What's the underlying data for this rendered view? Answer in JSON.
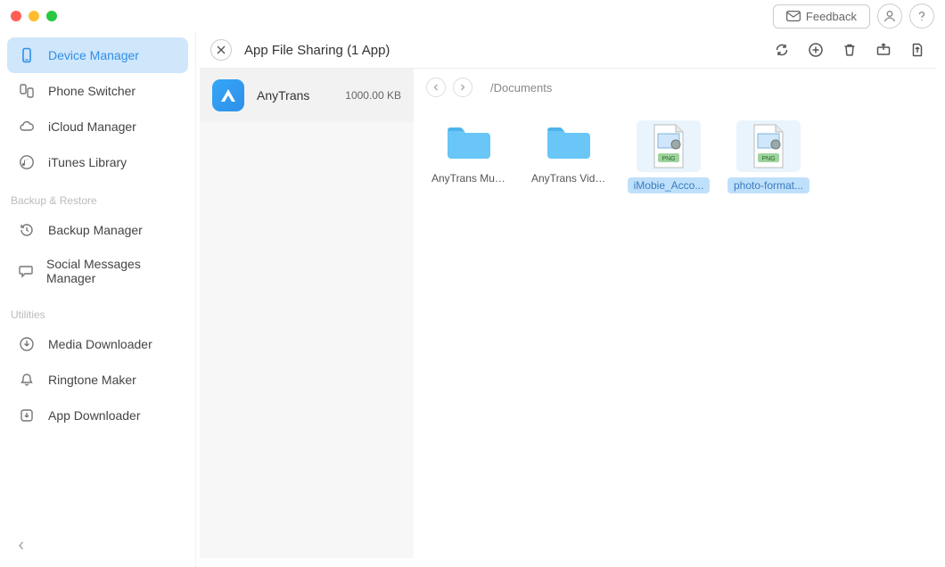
{
  "titlebar": {
    "feedback_label": "Feedback"
  },
  "sidebar": {
    "items": [
      {
        "label": "Device Manager"
      },
      {
        "label": "Phone Switcher"
      },
      {
        "label": "iCloud Manager"
      },
      {
        "label": "iTunes Library"
      }
    ],
    "section_backup": "Backup & Restore",
    "backup_items": [
      {
        "label": "Backup Manager"
      },
      {
        "label": "Social Messages Manager"
      }
    ],
    "section_util": "Utilities",
    "util_items": [
      {
        "label": "Media Downloader"
      },
      {
        "label": "Ringtone Maker"
      },
      {
        "label": "App Downloader"
      }
    ]
  },
  "header": {
    "title": "App File Sharing (1 App)"
  },
  "app_list": [
    {
      "name": "AnyTrans",
      "size": "1000.00 KB"
    }
  ],
  "nav": {
    "path": "/Documents"
  },
  "files": [
    {
      "name": "AnyTrans Music",
      "type": "folder",
      "selected": false
    },
    {
      "name": "AnyTrans Video",
      "type": "folder",
      "selected": false
    },
    {
      "name": "iMobie_Acco...",
      "type": "png",
      "selected": true
    },
    {
      "name": "photo-format...",
      "type": "png",
      "selected": true
    }
  ],
  "png_badge": "PNG"
}
